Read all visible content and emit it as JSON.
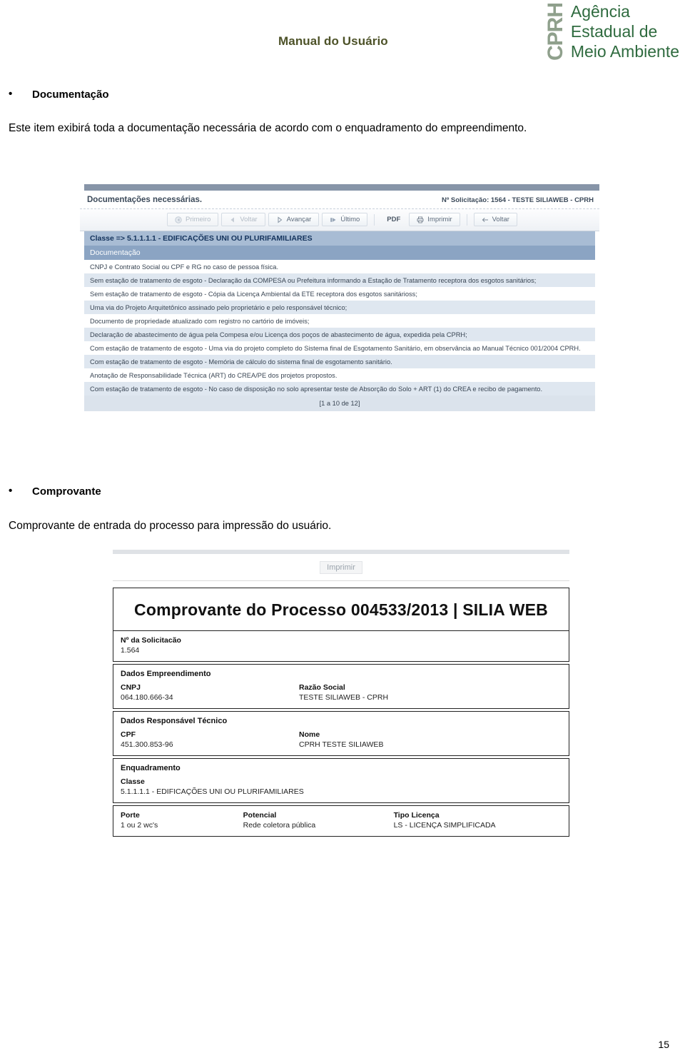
{
  "header": {
    "title": "Manual do Usuário",
    "logo": {
      "acronym": "CPRH",
      "line1": "Agência",
      "line2": "Estadual de",
      "line3": "Meio Ambiente"
    }
  },
  "sections": [
    {
      "heading": "Documentação",
      "paragraph": "Este item exibirá toda a documentação necessária de acordo com o enquadramento do empreendimento."
    },
    {
      "heading": "Comprovante",
      "paragraph": "Comprovante de entrada do processo para impressão do usuário."
    }
  ],
  "screenshot_documentacoes": {
    "title": "Documentações necessárias.",
    "solicitacao": "Nº Solicitação: 1564 - TESTE SILIAWEB - CPRH",
    "toolbar": [
      {
        "label": "Primeiro",
        "icon": "first-page-icon",
        "disabled": true
      },
      {
        "label": "Voltar",
        "icon": "previous-page-icon",
        "disabled": true
      },
      {
        "label": "Avançar",
        "icon": "next-page-icon",
        "disabled": false
      },
      {
        "label": "Último",
        "icon": "last-page-icon",
        "disabled": false
      },
      {
        "label": "PDF",
        "icon": "pdf-icon",
        "disabled": false
      },
      {
        "label": "Imprimir",
        "icon": "printer-icon",
        "disabled": false
      },
      {
        "label": "Voltar",
        "icon": "back-arrow-icon",
        "disabled": false
      }
    ],
    "class_row": "Classe => 5.1.1.1.1 - EDIFICAÇÕES UNI OU PLURIFAMILIARES",
    "column_header": "Documentação",
    "rows": [
      "CNPJ e Contrato Social ou CPF e RG no caso de pessoa física.",
      "Sem estação de tratamento de esgoto - Declaração da COMPESA ou Prefeitura informando a Estação de Tratamento receptora dos esgotos sanitários;",
      "Sem estação de tratamento de esgoto - Cópia da Licença Ambiental da ETE receptora dos esgotos sanitárioss;",
      "Uma via do Projeto Arquitetônico assinado pelo proprietário e pelo responsável técnico;",
      "Documento de propriedade atualizado com registro no cartório de imóveis;",
      "Declaração de abastecimento de água pela Compesa e/ou Licença dos poços de abastecimento de água, expedida pela CPRH;",
      "Com estação de tratamento de esgoto - Uma via do projeto completo do Sistema final de Esgotamento Sanitário, em observância ao Manual Técnico 001/2004 CPRH.",
      "Com estação de tratamento de esgoto - Memória de cálculo do sistema final de esgotamento sanitário.",
      "Anotação de Responsabilidade Técnica (ART) do CREA/PE dos projetos propostos.",
      "Com estação de tratamento de esgoto - No caso de disposição no solo apresentar teste de Absorção do Solo + ART (1) do CREA e recibo de pagamento."
    ],
    "pagination": "[1 a 10 de 12]"
  },
  "screenshot_comprovante": {
    "print_button": "Imprimir",
    "title": "Comprovante do Processo 004533/2013 | SILIA WEB",
    "solicitacao": {
      "label": "Nº da Solicitacão",
      "value": "1.564"
    },
    "empreendimento": {
      "section": "Dados Empreendimento",
      "cnpj_label": "CNPJ",
      "cnpj_value": "064.180.666-34",
      "razao_label": "Razão Social",
      "razao_value": "TESTE SILIAWEB - CPRH"
    },
    "responsavel": {
      "section": "Dados Responsável Técnico",
      "cpf_label": "CPF",
      "cpf_value": "451.300.853-96",
      "nome_label": "Nome",
      "nome_value": "CPRH TESTE SILIAWEB"
    },
    "enquadramento": {
      "section": "Enquadramento",
      "classe_label": "Classe",
      "classe_value": "5.1.1.1.1 - EDIFICAÇÕES UNI OU PLURIFAMILIARES"
    },
    "licenca": {
      "porte_label": "Porte",
      "porte_value": "1 ou 2 wc's",
      "potencial_label": "Potencial",
      "potencial_value": "Rede coletora pública",
      "tipo_label": "Tipo Licença",
      "tipo_value": "LS - LICENÇA SIMPLIFICADA"
    }
  },
  "page_number": "15",
  "colors": {
    "header_title": "#4d5228",
    "logo_acronym": "#8fa08c",
    "logo_text": "#2f6b3f",
    "class_row_bg": "#a8bcd4",
    "subhead_bg": "#8ba4c3",
    "row_alt_bg": "#dfe7f0"
  }
}
